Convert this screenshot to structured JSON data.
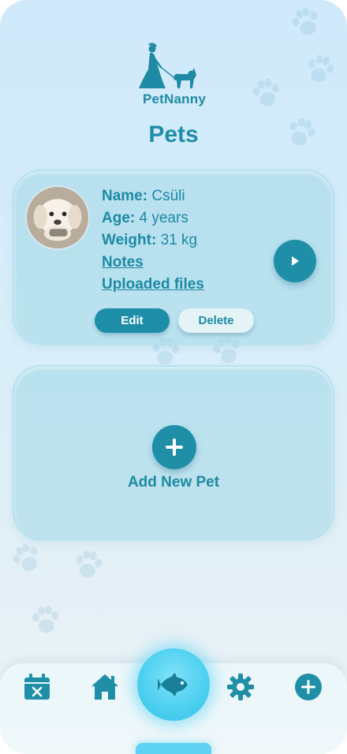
{
  "app": {
    "logo_text": "PetNanny"
  },
  "page": {
    "title": "Pets"
  },
  "pet": {
    "name_label": "Name:",
    "name": "Csüli",
    "age_label": "Age:",
    "age": "4 years",
    "weight_label": "Weight:",
    "weight": "31 kg",
    "notes_link": "Notes",
    "files_link": "Uploaded files",
    "edit_label": "Edit",
    "delete_label": "Delete"
  },
  "add_pet": {
    "label": "Add New Pet"
  },
  "nav": {
    "items": [
      {
        "icon": "calendar-x-icon"
      },
      {
        "icon": "home-icon"
      },
      {
        "icon": "fish-icon",
        "active": true
      },
      {
        "icon": "gear-icon"
      },
      {
        "icon": "plus-circle-icon"
      }
    ]
  },
  "colors": {
    "accent": "#1f8fa8",
    "active_glow": "#4fd0f0",
    "background_top": "#cfe9fb"
  }
}
